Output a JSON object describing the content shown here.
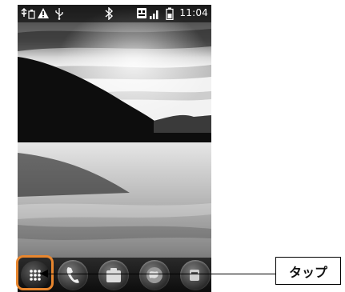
{
  "status_bar": {
    "time": "11:04",
    "icons": [
      "usb-debug-icon",
      "warning-icon",
      "usb-icon",
      "bluetooth-icon",
      "data-off-icon",
      "signal-icon",
      "battery-icon"
    ]
  },
  "dock": {
    "buttons": [
      "apps-grid-icon",
      "phone-icon",
      "contacts-icon",
      "browser-icon",
      "messaging-icon"
    ]
  },
  "callout": {
    "label": "タップ",
    "highlight_color": "#e8862e"
  }
}
